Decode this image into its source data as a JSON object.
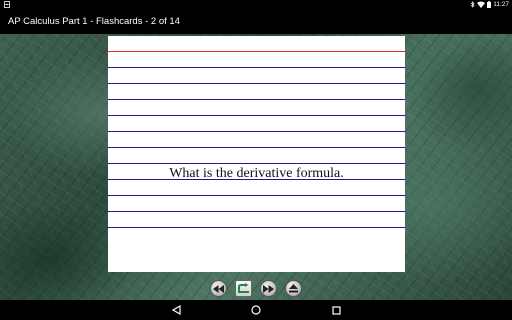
{
  "status_bar": {
    "time": "11:27",
    "icons": [
      "notification-icon",
      "bluetooth-icon",
      "wifi-icon",
      "battery-icon"
    ]
  },
  "app": {
    "title": "AP Calculus Part 1 - Flashcards - 2 of 14"
  },
  "card": {
    "text": "What is the derivative formula."
  },
  "controls": {
    "buttons": [
      "rewind-icon",
      "flip-card-icon",
      "fast-forward-icon",
      "eject-icon"
    ]
  },
  "colors": {
    "card_line_blue": "#1e1a8c",
    "card_line_red": "#d8301c",
    "background_leather": "#3f6151"
  },
  "nav": {
    "buttons": [
      "back-icon",
      "home-icon",
      "recents-icon"
    ]
  }
}
